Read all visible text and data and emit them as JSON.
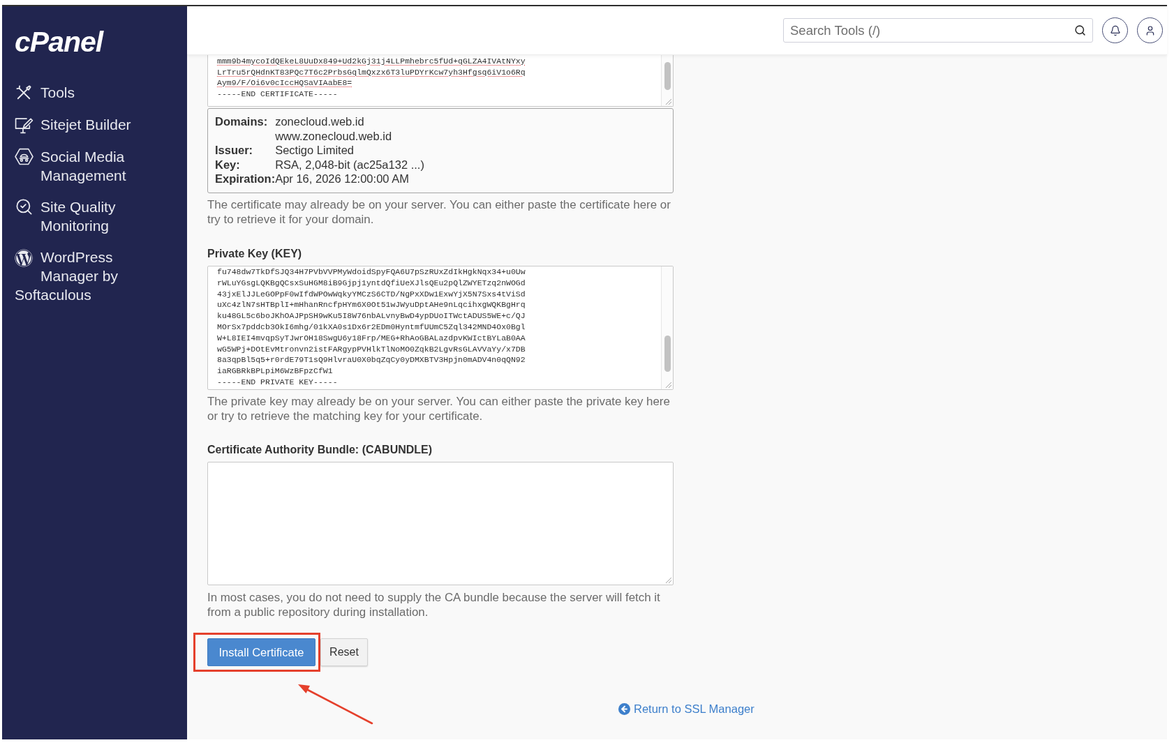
{
  "sidebar": {
    "logo": "cPanel",
    "items": [
      {
        "label": "Tools"
      },
      {
        "label": "Sitejet Builder"
      },
      {
        "label": "Social Media Management"
      },
      {
        "label": "Site Quality Monitoring"
      },
      {
        "label": "WordPress Manager by Softaculous"
      }
    ]
  },
  "header": {
    "search": {
      "placeholder": "Search Tools (/)"
    }
  },
  "certificate": {
    "lines": [
      {
        "text": "mmm9b4mycoIdQEkeL8UuDx849+Ud2kGj31j4LLPmhebrc5fUd+qGLZA4IVAtNYxy",
        "flagged": true
      },
      {
        "text": "LrTru5rQHdnKT83PQc7T6c2PrbsGqlmQxzx6T3luPDYrKcw7yh3Hfgsq6iV1o6Rq",
        "flagged": true
      },
      {
        "text": "Aym9/F/Oi6v0cIccHQSaVIAabE8=",
        "flagged": true
      },
      {
        "text": "-----END CERTIFICATE-----",
        "flagged": false
      }
    ],
    "details": [
      {
        "label": "Domains:",
        "values": [
          "zonecloud.web.id",
          "www.zonecloud.web.id"
        ]
      },
      {
        "label": "Issuer:",
        "values": [
          "Sectigo Limited"
        ]
      },
      {
        "label": "Key:",
        "values": [
          "RSA, 2,048-bit (ac25a132 ...)"
        ]
      },
      {
        "label": "Expiration:",
        "values": [
          "Apr 16, 2026 12:00:00 AM"
        ]
      }
    ],
    "help": "The certificate may already be on your server. You can either paste the certificate here or try to retrieve it for your domain."
  },
  "private_key": {
    "label": "Private Key (KEY)",
    "lines": [
      "fu748dw7TkDfSJQ34H7PVbVVPMyWdoidSpyFQA6U7pSzRUxZdIkHgkNqx34+u0Uw",
      "rWLuYGsgLQKBgQCsxSuHGM8iB9Gjpj1yntdQfiUeXJlsQEu2pQlZWYETzq2nWOGd",
      "43jxElJJLeGOPpF0wIfdWPOwWqkyYMCzS6CTD/NgPxXDw1ExwYjX5N7Sxs4tViSd",
      "uXc4zlN7sHTBplI+mHhanRncfpHYm6X0Ot51wJWyuDptAHe9nLqcihxgWQKBgHrq",
      "ku48GL5c6boJKhOAJPpSH9wKu5I8W76nbALvnyBwD4ypDUoITWctADUS5WE+c/QJ",
      "MOrSx7pddcb3OkI6mhg/01kXA0s1Dx6r2EDm0HyntmfUUmC5Zql342MND4Ox0Bgl",
      "W+L8IEI4mvqpSyTJwrOH18SwgU6y18Frp/MEG+RhAoGBALazdpvKWIctBYLaB0AA",
      "wG5WPj+DOtEvMtronvn2istFARgypPVHlkTlNoMO0ZqkB2LgvRsGLAVVaYy/x7DB",
      "8a3qpBl5q5+r0rdE79T1sQ9HlvraU0X0bqZqCy0yDMXBTV3Hpjn0mADV4n0qQN92",
      "iaRGBRkBPLpiM6WzBFpzCfW1",
      "-----END PRIVATE KEY-----"
    ],
    "help": "The private key may already be on your server. You can either paste the private key here or try to retrieve the matching key for your certificate."
  },
  "ca_bundle": {
    "label": "Certificate Authority Bundle: (CABUNDLE)",
    "help": "In most cases, you do not need to supply the CA bundle because the server will fetch it from a public repository during installation."
  },
  "buttons": [
    {
      "kind": "primary",
      "label": "Install Certificate",
      "highlighted": true
    },
    {
      "kind": "secondary",
      "label": "Reset",
      "highlighted": false
    }
  ],
  "return_link": "Return to SSL Manager"
}
